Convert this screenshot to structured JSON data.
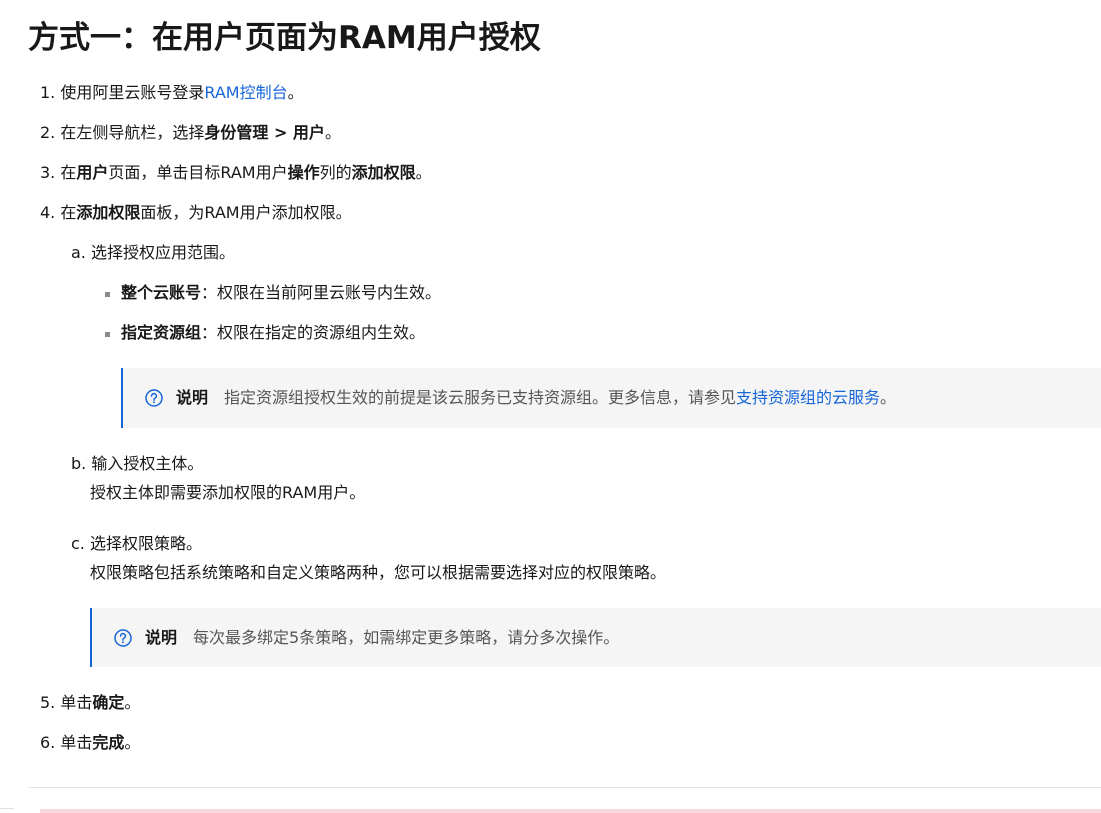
{
  "title": "方式一：在用户页面为RAM用户授权",
  "steps": {
    "s1": {
      "num": "1.",
      "text": "使用阿里云账号登录",
      "link": "RAM控制台",
      "end": "。"
    },
    "s2": {
      "num": "2.",
      "pre": "在左侧导航栏，选择",
      "b1": "身份管理 > 用户",
      "end": "。"
    },
    "s3": {
      "num": "3.",
      "pre": "在",
      "b1": "用户",
      "mid1": "页面，单击目标RAM用户",
      "b2": "操作",
      "mid2": "列的",
      "b3": "添加权限",
      "end": "。"
    },
    "s4": {
      "num": "4.",
      "pre": "在",
      "b1": "添加权限",
      "text": "面板，为RAM用户添加权限。"
    },
    "s5": {
      "num": "5.",
      "pre": "单击",
      "b1": "确定",
      "end": "。"
    },
    "s6": {
      "num": "6.",
      "pre": "单击",
      "b1": "完成",
      "end": "。"
    }
  },
  "substeps": {
    "a": {
      "label": "a.",
      "text": "选择授权应用范围。"
    },
    "b": {
      "label": "b.",
      "text": "输入授权主体。",
      "desc": "授权主体即需要添加权限的RAM用户。"
    },
    "c": {
      "label": "c.",
      "text": "选择权限策略。",
      "desc": "权限策略包括系统策略和自定义策略两种，您可以根据需要选择对应的权限策略。"
    }
  },
  "bullets": [
    {
      "term": "整个云账号",
      "sep": "：",
      "desc": "权限在当前阿里云账号内生效。"
    },
    {
      "term": "指定资源组",
      "sep": "：",
      "desc": "权限在指定的资源组内生效。"
    }
  ],
  "notes": {
    "n1": {
      "label": "说明",
      "text": "指定资源组授权生效的前提是该云服务已支持资源组。更多信息，请参见",
      "link": "支持资源组的云服务",
      "end": "。"
    },
    "n2": {
      "label": "说明",
      "text": "每次最多绑定5条策略，如需绑定更多策略，请分多次操作。"
    }
  },
  "colors": {
    "accent": "#1766d8",
    "note_bg": "#f5f5f5",
    "text": "#181818"
  },
  "icons": {
    "note": "question-circle-icon"
  }
}
